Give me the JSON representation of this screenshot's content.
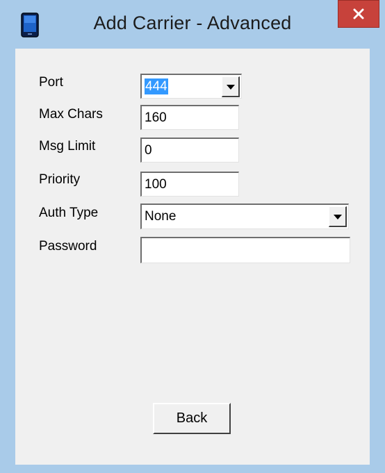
{
  "window": {
    "title": "Add Carrier - Advanced",
    "close_icon": "close-icon",
    "app_icon": "phone-icon",
    "frame_color": "#a9cbe9",
    "close_color": "#c7423b"
  },
  "form": {
    "port": {
      "label": "Port",
      "value": "444"
    },
    "max_chars": {
      "label": "Max Chars",
      "value": "160"
    },
    "msg_limit": {
      "label": "Msg Limit",
      "value": "0"
    },
    "priority": {
      "label": "Priority",
      "value": "100"
    },
    "auth_type": {
      "label": "Auth Type",
      "value": "None"
    },
    "password": {
      "label": "Password",
      "value": ""
    }
  },
  "buttons": {
    "back_label": "Back"
  }
}
